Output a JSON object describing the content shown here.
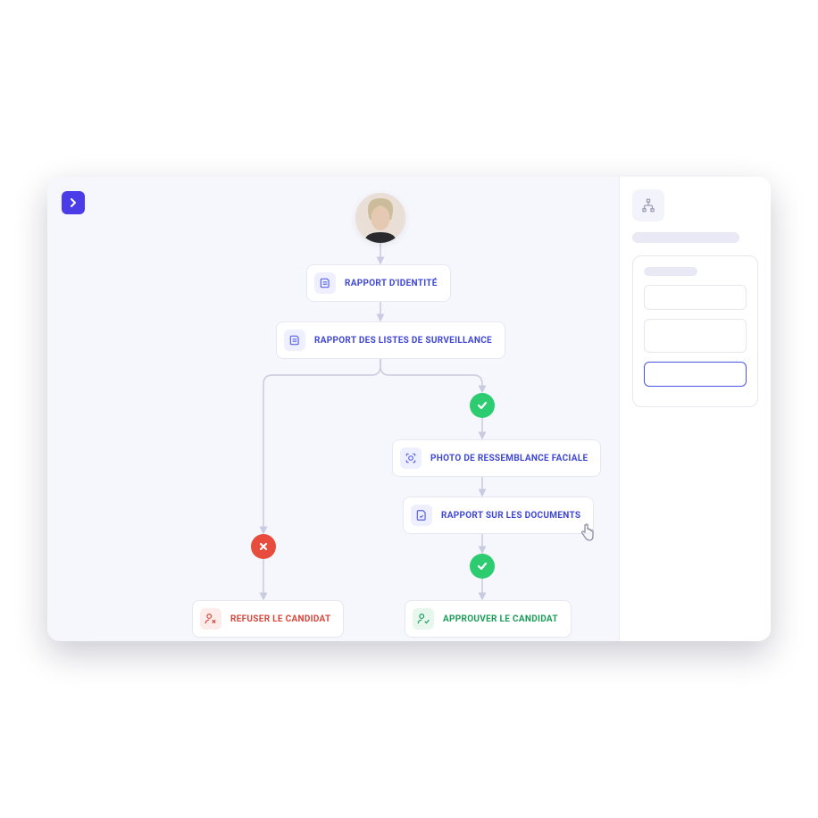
{
  "flow": {
    "identity_report": "RAPPORT D'IDENTITÉ",
    "watchlist_report": "RAPPORT DES LISTES DE SURVEILLANCE",
    "facial_similarity": "PHOTO DE RESSEMBLANCE FACIALE",
    "document_report": "RAPPORT SUR LES DOCUMENTS",
    "reject_candidate": "REFUSER LE CANDIDAT",
    "approve_candidate": "APPROUVER LE CANDIDAT"
  },
  "colors": {
    "primary": "#4a3de8",
    "success": "#2ecc71",
    "danger": "#e74c3c"
  }
}
